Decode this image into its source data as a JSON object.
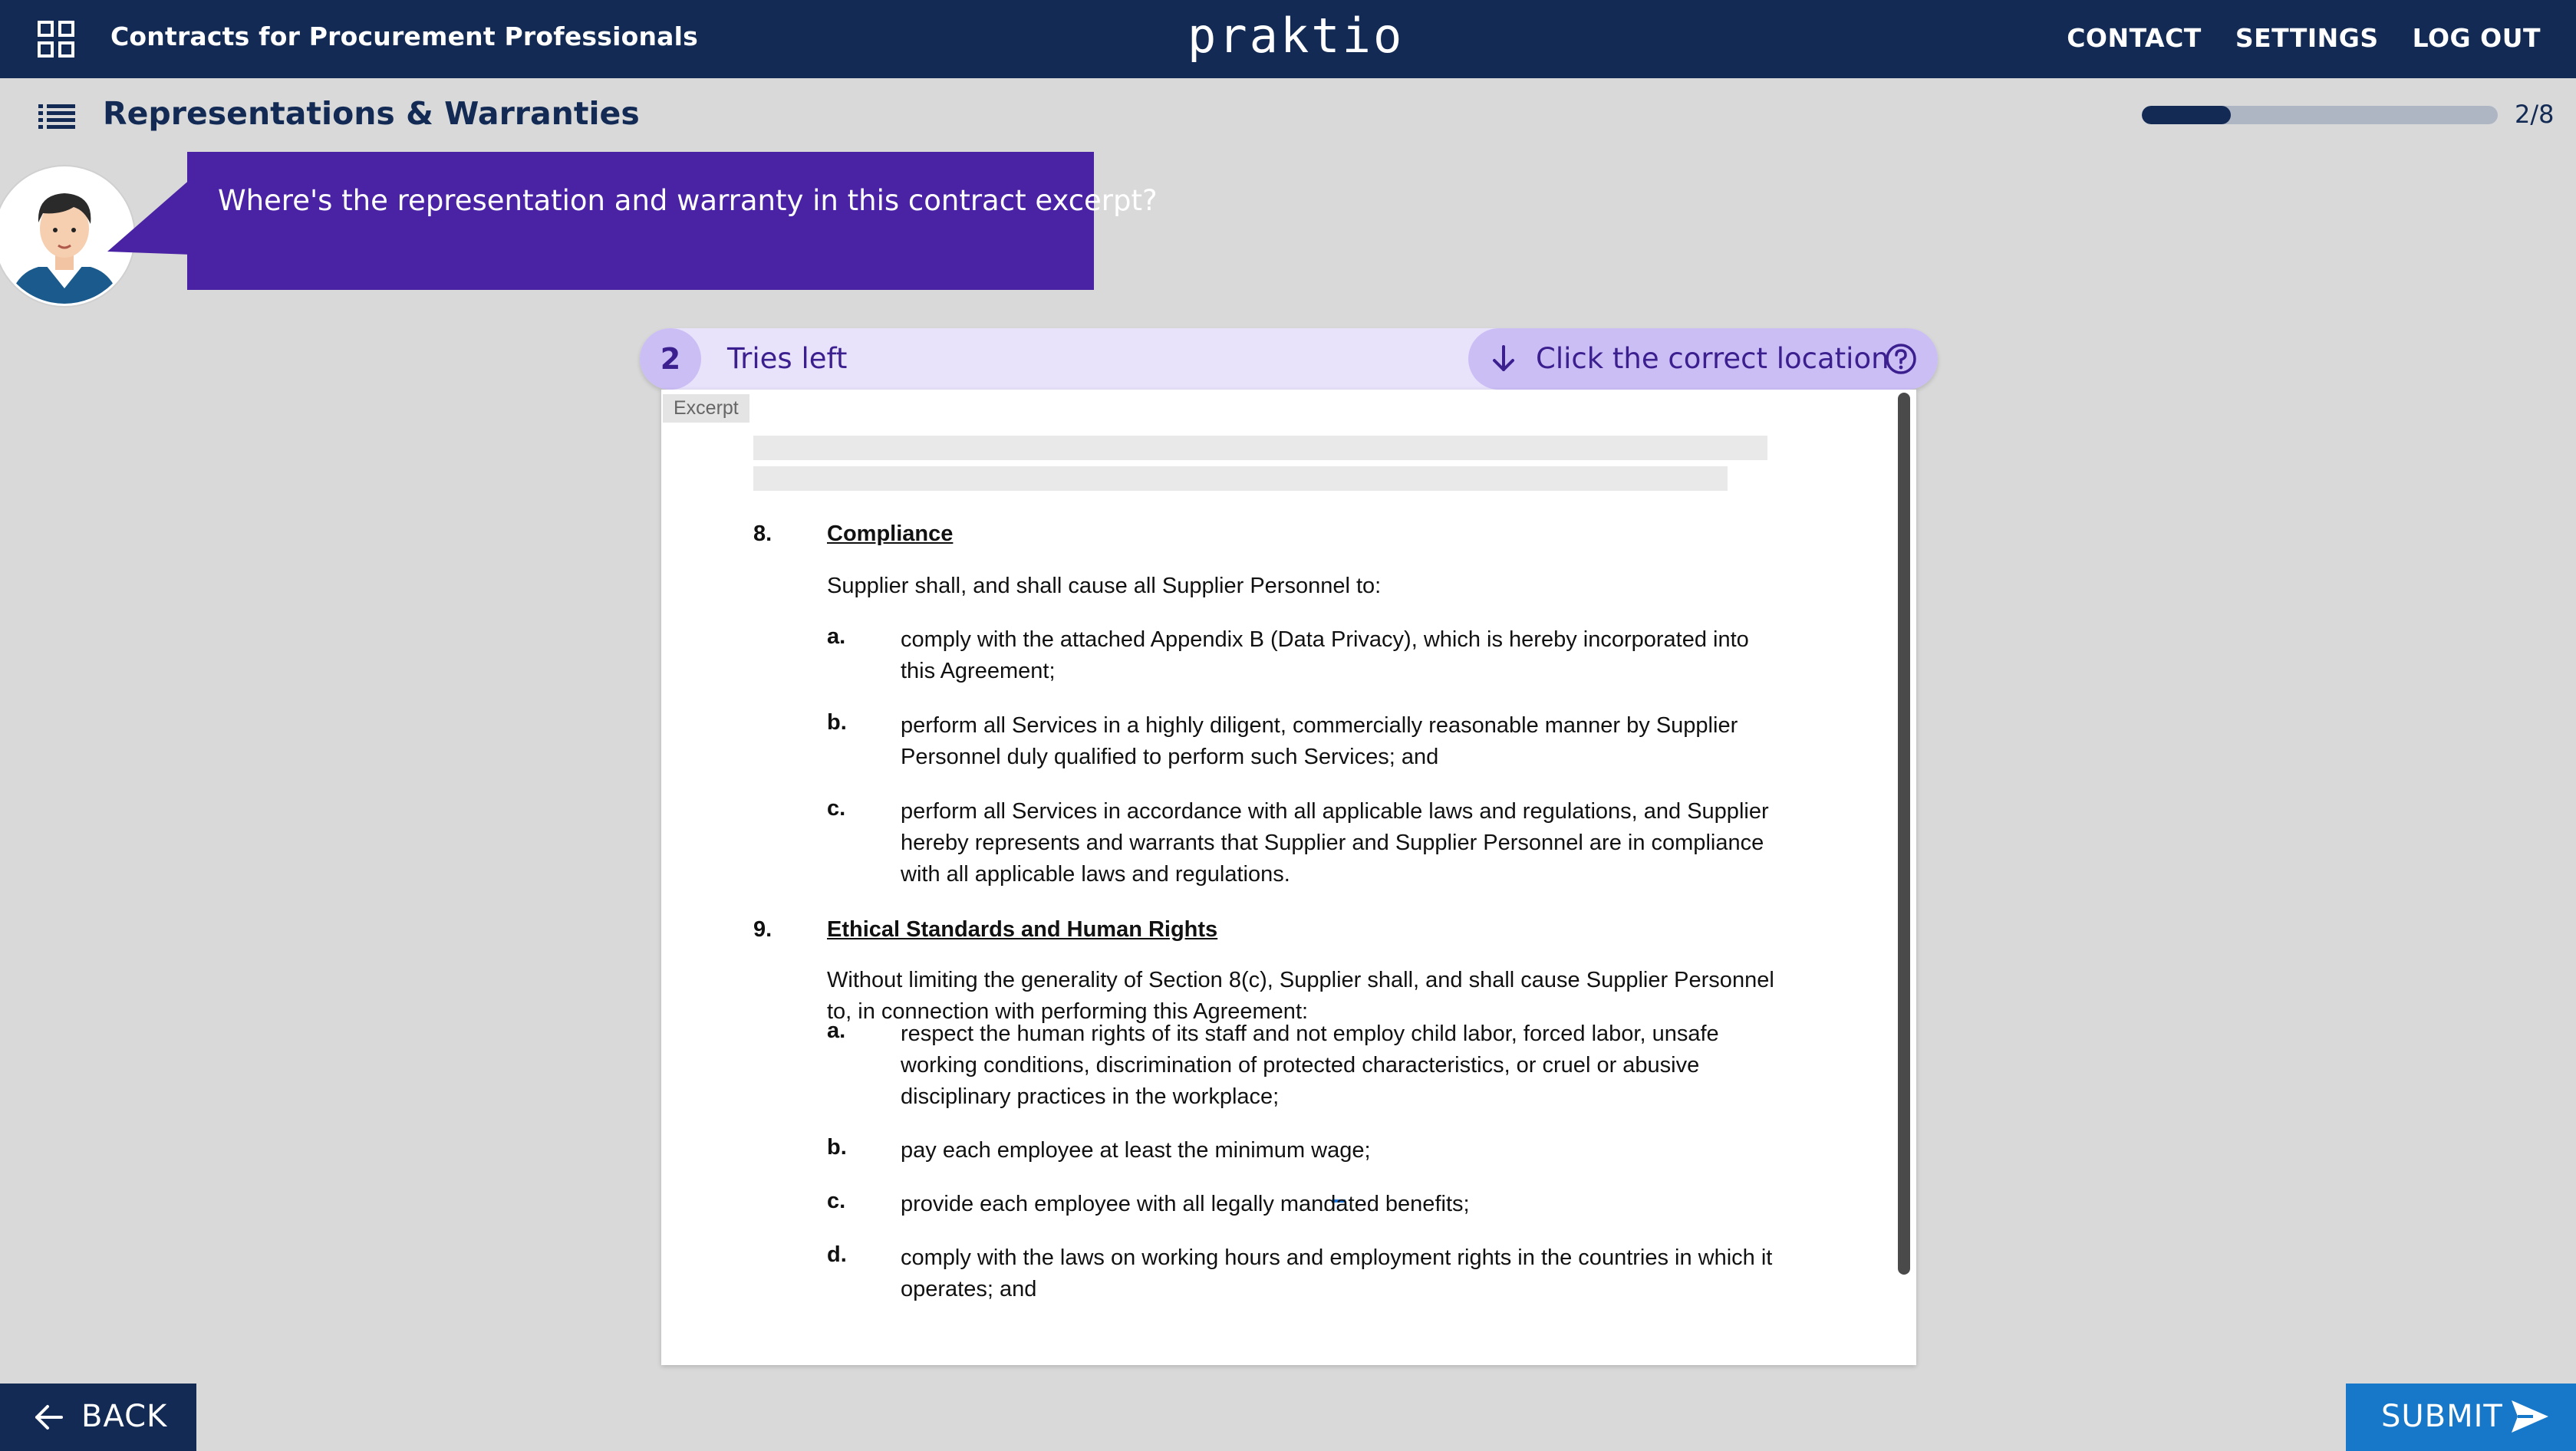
{
  "topbar": {
    "course_title": "Contracts for Procurement Professionals",
    "brand": "praktio",
    "nav": [
      "CONTACT",
      "SETTINGS",
      "LOG OUT"
    ]
  },
  "header": {
    "section_title": "Representations & Warranties",
    "progress_fraction": 0.25,
    "progress_text": "2/8"
  },
  "tutor": {
    "question": "Where's the representation and warranty in this contract excerpt?"
  },
  "exercise": {
    "tries_count": "2",
    "tries_label": "Tries left",
    "instruction": "Click the correct location",
    "icons": [
      "arrow-down-icon",
      "help-circle-icon"
    ]
  },
  "document": {
    "tag": "Excerpt",
    "section8": {
      "number": "8.",
      "heading": "Compliance",
      "intro": "Supplier shall, and shall cause all Supplier Personnel to:",
      "items": [
        {
          "label": "a.",
          "text": "comply with the attached Appendix B (Data Privacy), which is hereby incorporated into this Agreement;"
        },
        {
          "label": "b.",
          "text": "perform all Services in a highly diligent, commercially reasonable manner by Supplier Personnel duly qualified to perform such Services; and"
        },
        {
          "label": "c.",
          "text": "perform all Services in accordance with all applicable laws and regulations, and Supplier hereby represents and warrants that Supplier and Supplier Personnel are in compliance with all applicable laws and regulations."
        }
      ]
    },
    "section9": {
      "number": "9.",
      "heading": "Ethical Standards and Human Rights",
      "intro": "Without limiting the generality of Section 8(c), Supplier shall, and shall cause Supplier Personnel to, in connection with performing this Agreement:",
      "items": [
        {
          "label": "a.",
          "text": "respect the human rights of its staff and not employ child labor, forced labor, unsafe working conditions, discrimination of protected characteristics, or cruel or abusive disciplinary practices in the workplace;"
        },
        {
          "label": "b.",
          "text": "pay each employee at least the minimum wage;"
        },
        {
          "label": "c.",
          "text": "provide each employee with all legally mandated benefits;"
        },
        {
          "label": "d.",
          "text": "comply with the laws on working hours and employment rights in the countries in which it operates; and"
        }
      ]
    }
  },
  "footer": {
    "back_label": "BACK",
    "submit_label": "SUBMIT"
  },
  "colors": {
    "navy": "#122a54",
    "purple": "#4a23a5",
    "lavender": "#e8e2fb",
    "submit_blue": "#1777c8"
  }
}
